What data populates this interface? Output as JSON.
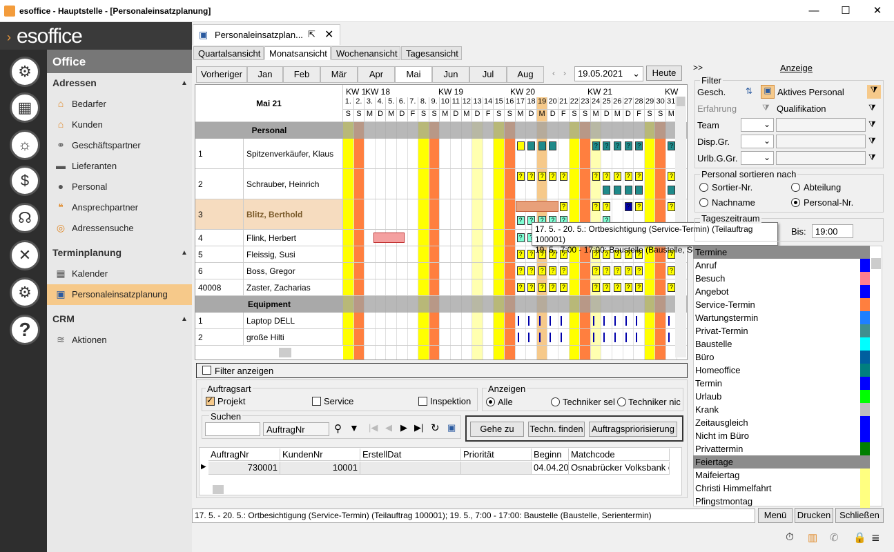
{
  "window": {
    "title": "esoffice - Hauptstelle - [Personaleinsatzplanung]",
    "minimize": "—",
    "maximize": "☐",
    "close": "✕"
  },
  "logo": "esoffice",
  "nav": {
    "office": "Office",
    "adressen": {
      "title": "Adressen",
      "items": [
        "Bedarfer",
        "Kunden",
        "Geschäftspartner",
        "Lieferanten",
        "Personal",
        "Ansprechpartner",
        "Adressensuche"
      ]
    },
    "termin": {
      "title": "Terminplanung",
      "items": [
        "Kalender",
        "Personaleinsatzplanung"
      ]
    },
    "crm": {
      "title": "CRM",
      "items": [
        "Aktionen"
      ]
    }
  },
  "doctab": {
    "title": "Personaleinsatzplan..."
  },
  "viewtabs": [
    "Quartalsansicht",
    "Monatsansicht",
    "Wochenansicht",
    "Tagesansicht"
  ],
  "months": [
    "Vorheriger",
    "Jan",
    "Feb",
    "Mär",
    "Apr",
    "Mai",
    "Jun",
    "Jul",
    "Aug"
  ],
  "date": "19.05.2021",
  "heute": "Heute",
  "grid": {
    "month_label": "Mai 21",
    "weeks": [
      "KW 1",
      "KW 18",
      "KW 19",
      "KW 20",
      "KW 21",
      "KW"
    ],
    "day_nums": [
      "1.",
      "2.",
      "3.",
      "4.",
      "5.",
      "6.",
      "7.",
      "8.",
      "9.",
      "10",
      "11",
      "12",
      "13",
      "14",
      "15",
      "16",
      "17",
      "18",
      "19",
      "20",
      "21",
      "22",
      "23",
      "24",
      "25",
      "26",
      "27",
      "28",
      "29",
      "30",
      "31"
    ],
    "day_abbr": [
      "S",
      "S",
      "M",
      "D",
      "M",
      "D",
      "F",
      "S",
      "S",
      "M",
      "D",
      "M",
      "D",
      "F",
      "S",
      "S",
      "M",
      "D",
      "M",
      "D",
      "F",
      "S",
      "S",
      "M",
      "D",
      "M",
      "D",
      "F",
      "S",
      "S",
      "M"
    ],
    "personal_title": "Personal",
    "equipment_title": "Equipment",
    "personal": [
      {
        "nr": "1",
        "name": "Spitzenverkäufer, Klaus"
      },
      {
        "nr": "2",
        "name": "Schrauber, Heinrich"
      },
      {
        "nr": "3",
        "name": "Blitz, Berthold"
      },
      {
        "nr": "4",
        "name": "Flink, Herbert"
      },
      {
        "nr": "5",
        "name": "Fleissig, Susi"
      },
      {
        "nr": "6",
        "name": "Boss, Gregor"
      },
      {
        "nr": "40008",
        "name": "Zaster, Zacharias"
      }
    ],
    "equipment": [
      {
        "nr": "1",
        "name": "Laptop DELL"
      },
      {
        "nr": "2",
        "name": "große Hilti"
      }
    ]
  },
  "tooltip": {
    "line1": "17. 5. - 20. 5.: Ortbesichtigung (Service-Termin) (Teilauftrag 100001)",
    "line2": "19. 5., 7:00 - 17:00: Baustelle (Baustelle, Serientermin)"
  },
  "filter_show": "Filter anzeigen",
  "auftragsart": {
    "title": "Auftragsart",
    "projekt": "Projekt",
    "service": "Service",
    "inspektion": "Inspektion"
  },
  "anzeigen": {
    "title": "Anzeigen",
    "alle": "Alle",
    "tech1": "Techniker sel",
    "tech2": "Techniker nic"
  },
  "suchen": {
    "title": "Suchen",
    "field": "AuftragNr"
  },
  "buttons": {
    "gehe": "Gehe zu",
    "techn": "Techn. finden",
    "prio": "Auftragspriorisierung"
  },
  "table": {
    "cols": [
      "AuftragNr",
      "KundenNr",
      "ErstellDat",
      "Priorität",
      "Beginn",
      "Matchcode"
    ],
    "row": [
      "730001",
      "10001",
      "",
      "",
      "04.04.20",
      "Osnabrücker Volksbank e"
    ]
  },
  "status": "17. 5. - 20. 5.: Ortbesichtigung (Service-Termin) (Teilauftrag 100001); 19. 5., 7:00 - 17:00: Baustelle (Baustelle, Serientermin)",
  "bottom_buttons": [
    "Menü",
    "Drucken",
    "Schließen"
  ],
  "right": {
    "collapse": ">>",
    "title": "Anzeige",
    "filter": "Filter",
    "gesch": "Gesch.",
    "aktives": "Aktives Personal",
    "erfahrung": "Erfahrung",
    "qualifikation": "Qualifikation",
    "team": "Team",
    "dispgr": "Disp.Gr.",
    "urlb": "Urlb.G.Gr.",
    "sortieren": "Personal sortieren nach",
    "sort": [
      "Sortier-Nr.",
      "Abteilung",
      "Nachname",
      "Personal-Nr."
    ],
    "tageszeitraum": "Tageszeitraum",
    "bis": "Bis:",
    "bis_val": "19:00",
    "legend_head": "Termine",
    "legend": [
      {
        "label": "Anruf",
        "color": "#0000ff"
      },
      {
        "label": "Besuch",
        "color": "#ff7f8f"
      },
      {
        "label": "Angebot",
        "color": "#0000ff"
      },
      {
        "label": "Service-Termin",
        "color": "#ff7f3f"
      },
      {
        "label": "Wartungstermin",
        "color": "#1e7fff"
      },
      {
        "label": "Privat-Termin",
        "color": "#3f8f8f"
      },
      {
        "label": "Baustelle",
        "color": "#00ffff"
      },
      {
        "label": "Büro",
        "color": "#005f9f"
      },
      {
        "label": "Homeoffice",
        "color": "#007f7f"
      },
      {
        "label": "Termin",
        "color": "#0000ff"
      },
      {
        "label": "Urlaub",
        "color": "#00ff00"
      },
      {
        "label": "Krank",
        "color": "#bfbfbf"
      },
      {
        "label": "Zeitausgleich",
        "color": "#0000ff"
      },
      {
        "label": "Nicht im Büro",
        "color": "#0000ff"
      },
      {
        "label": "Privattermin",
        "color": "#007f00"
      }
    ],
    "feiertage_head": "Feiertage",
    "feiertage": [
      "Maifeiertag",
      "Christi Himmelfahrt",
      "Pfingstmontag"
    ]
  }
}
